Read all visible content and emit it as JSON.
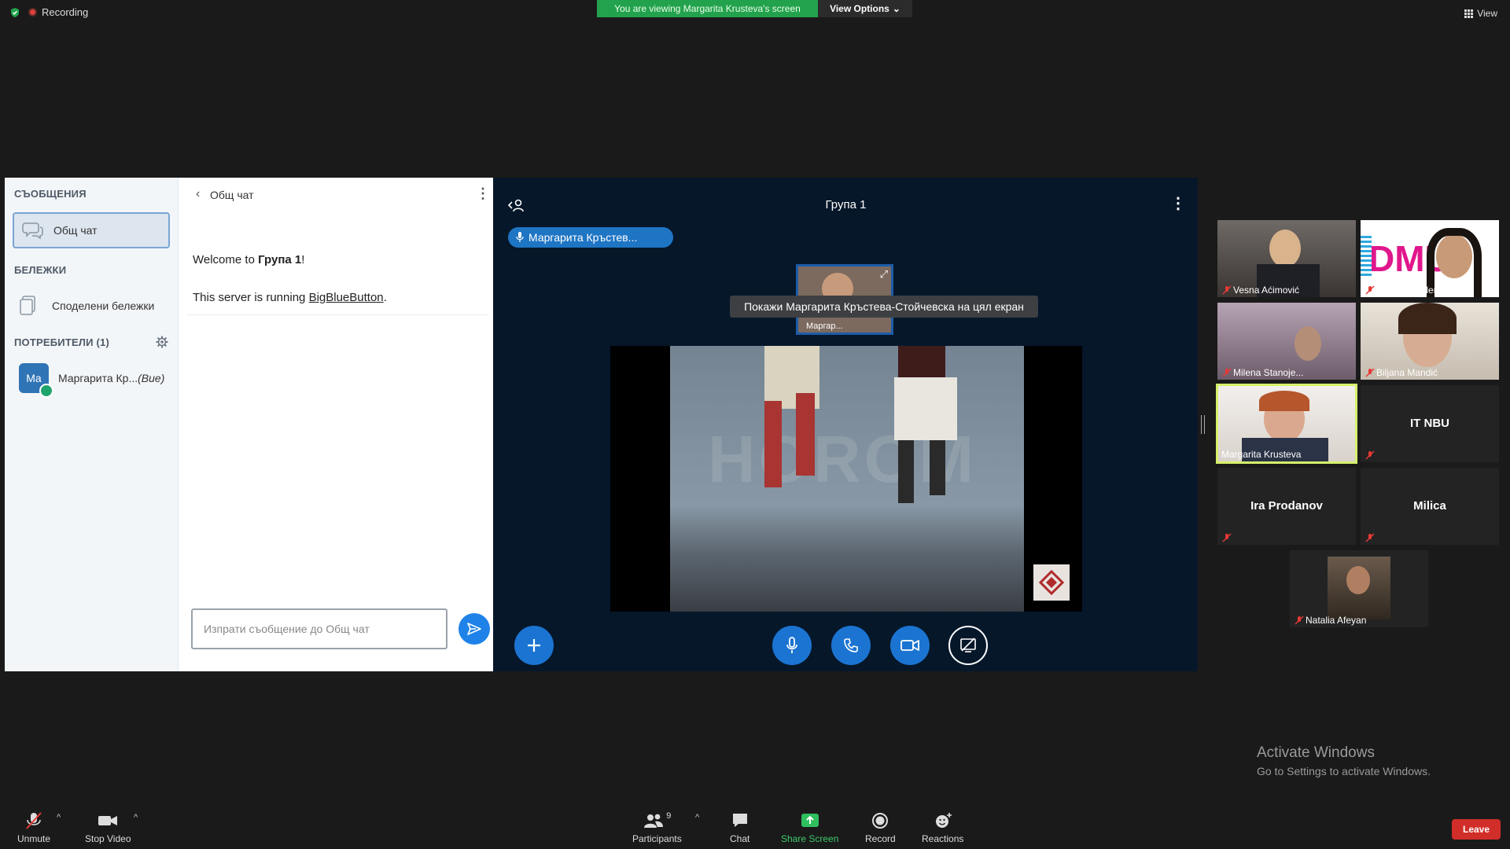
{
  "top": {
    "recording_label": "Recording",
    "viewing_banner": "You are viewing Margarita Krusteva's screen",
    "view_options_label": "View Options",
    "view_label": "View"
  },
  "bbb": {
    "nav": {
      "messages_heading": "СЪОБЩЕНИЯ",
      "public_chat_label": "Общ чат",
      "notes_heading": "БЕЛЕЖКИ",
      "shared_notes_label": "Споделени бележки",
      "users_heading": "ПОТРЕБИТЕЛИ (1)",
      "user_avatar_initials": "Ma",
      "user_name": "Маргарита Кр...",
      "user_you_tag": "(Вие)"
    },
    "chat": {
      "title": "Общ чат",
      "welcome_prefix": "Welcome to ",
      "welcome_group": "Група 1",
      "welcome_suffix": "!",
      "server_prefix": "This server is running ",
      "server_link": "BigBlueButton",
      "server_suffix": ".",
      "input_placeholder": "Изпрати съобщение до Общ чат"
    },
    "presentation": {
      "group_title": "Група 1",
      "talking_indicator": "Маргарита Кръстев...",
      "camera_thumb_name": "Маргар...",
      "fullscreen_tooltip": "Покажи Маргарита Кръстева-Стойчевска на цял екран",
      "video_watermark": "HOROM"
    }
  },
  "gallery": [
    {
      "name": "Vesna Aćimović",
      "type": "video",
      "muted": true
    },
    {
      "name": "Dušanka Jelenk...",
      "type": "video",
      "muted": true,
      "logo_text": "DMU"
    },
    {
      "name": "Milena Stanoje...",
      "type": "video",
      "muted": true
    },
    {
      "name": "Biljana Mandić",
      "type": "video",
      "muted": true
    },
    {
      "name": "Margarita Krusteva",
      "type": "video",
      "muted": false,
      "active_speaker": true
    },
    {
      "name": "IT NBU",
      "type": "name-only",
      "muted": true
    },
    {
      "name": "Ira Prodanov",
      "type": "name-only",
      "muted": true
    },
    {
      "name": "Milica",
      "type": "name-only",
      "muted": true
    },
    {
      "name": "Natalia Afeyan",
      "type": "video",
      "muted": true
    }
  ],
  "activation": {
    "title": "Activate Windows",
    "subtitle": "Go to Settings to activate Windows."
  },
  "toolbar": {
    "unmute_label": "Unmute",
    "stop_video_label": "Stop Video",
    "participants_label": "Participants",
    "participants_count": "9",
    "chat_label": "Chat",
    "share_screen_label": "Share Screen",
    "record_label": "Record",
    "reactions_label": "Reactions",
    "leave_label": "Leave"
  },
  "colors": {
    "share_green": "#23a24d",
    "bbb_blue": "#1b74d1",
    "leave_red": "#d12d29",
    "active_speaker_border": "#d6f06a"
  }
}
